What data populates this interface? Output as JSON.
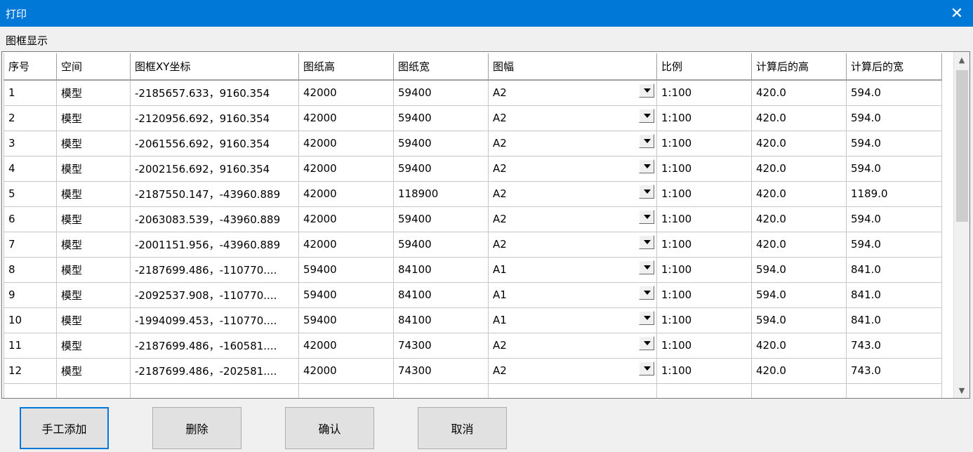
{
  "window": {
    "title": "打印"
  },
  "section_label": "图框显示",
  "columns": [
    "序号",
    "空间",
    "图框XY坐标",
    "图纸高",
    "图纸宽",
    "图幅",
    "比例",
    "计算后的高",
    "计算后的宽"
  ],
  "rows": [
    [
      "1",
      "模型",
      "-2185657.633，9160.354",
      "42000",
      "59400",
      "A2",
      "1:100",
      "420.0",
      "594.0"
    ],
    [
      "2",
      "模型",
      "-2120956.692，9160.354",
      "42000",
      "59400",
      "A2",
      "1:100",
      "420.0",
      "594.0"
    ],
    [
      "3",
      "模型",
      "-2061556.692，9160.354",
      "42000",
      "59400",
      "A2",
      "1:100",
      "420.0",
      "594.0"
    ],
    [
      "4",
      "模型",
      "-2002156.692，9160.354",
      "42000",
      "59400",
      "A2",
      "1:100",
      "420.0",
      "594.0"
    ],
    [
      "5",
      "模型",
      "-2187550.147，-43960.889",
      "42000",
      "118900",
      "A2",
      "1:100",
      "420.0",
      "1189.0"
    ],
    [
      "6",
      "模型",
      "-2063083.539，-43960.889",
      "42000",
      "59400",
      "A2",
      "1:100",
      "420.0",
      "594.0"
    ],
    [
      "7",
      "模型",
      "-2001151.956，-43960.889",
      "42000",
      "59400",
      "A2",
      "1:100",
      "420.0",
      "594.0"
    ],
    [
      "8",
      "模型",
      "-2187699.486，-110770....",
      "59400",
      "84100",
      "A1",
      "1:100",
      "594.0",
      "841.0"
    ],
    [
      "9",
      "模型",
      "-2092537.908，-110770....",
      "59400",
      "84100",
      "A1",
      "1:100",
      "594.0",
      "841.0"
    ],
    [
      "10",
      "模型",
      "-1994099.453，-110770....",
      "59400",
      "84100",
      "A1",
      "1:100",
      "594.0",
      "841.0"
    ],
    [
      "11",
      "模型",
      "-2187699.486，-160581....",
      "42000",
      "74300",
      "A2",
      "1:100",
      "420.0",
      "743.0"
    ],
    [
      "12",
      "模型",
      "-2187699.486，-202581....",
      "42000",
      "74300",
      "A2",
      "1:100",
      "420.0",
      "743.0"
    ]
  ],
  "buttons": {
    "manual_add": "手工添加",
    "delete": "删除",
    "confirm": "确认",
    "cancel": "取消"
  },
  "colors": {
    "titlebar": "#0078d7",
    "default_button_border": "#0078d7"
  }
}
